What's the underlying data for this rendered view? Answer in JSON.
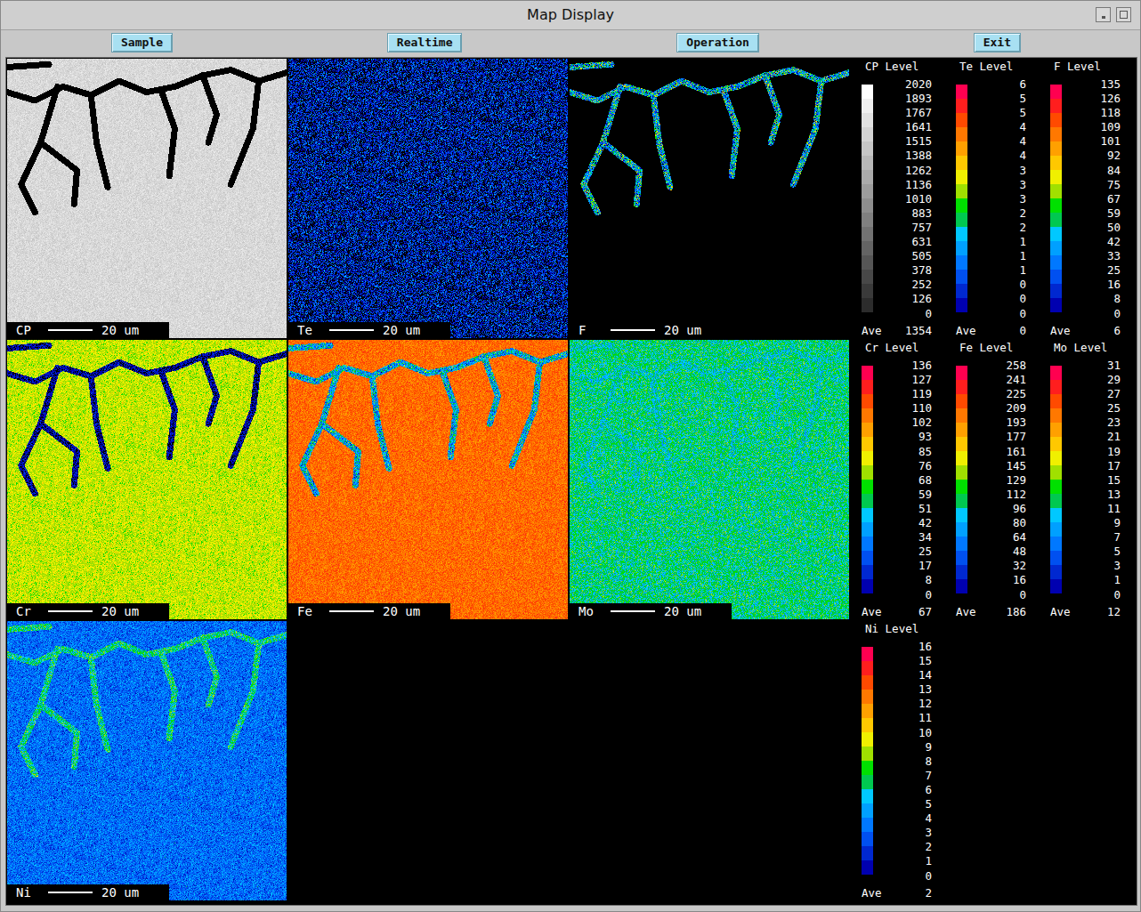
{
  "window": {
    "title": "Map Display",
    "controls": [
      "minimize",
      "maximize"
    ]
  },
  "toolbar": {
    "buttons": [
      "Sample",
      "Realtime",
      "Operation",
      "Exit"
    ]
  },
  "maps": [
    {
      "label": "CP",
      "scale_bar": "20 um",
      "scale": 0,
      "level": 0.8,
      "spread": 0.05,
      "boundary_level": -0.3,
      "boundary_spread": 0.05
    },
    {
      "label": "Te",
      "scale_bar": "20 um",
      "scale": 1,
      "level": 0.04,
      "spread": 0.16,
      "boundary_level": 0.04,
      "boundary_spread": 0.16
    },
    {
      "label": "F",
      "scale_bar": "20 um",
      "scale": 2,
      "level": -0.3,
      "spread": 0.03,
      "boundary_level": 0.3,
      "boundary_spread": 0.22
    },
    {
      "label": "Cr",
      "scale_bar": "20 um",
      "scale": 3,
      "level": 0.56,
      "spread": 0.05,
      "boundary_level": 0.03,
      "boundary_spread": 0.07
    },
    {
      "label": "Fe",
      "scale_bar": "20 um",
      "scale": 4,
      "level": 0.8,
      "spread": 0.05,
      "boundary_level": 0.3,
      "boundary_spread": 0.15
    },
    {
      "label": "Mo",
      "scale_bar": "20 um",
      "scale": 5,
      "level": 0.4,
      "spread": 0.08,
      "boundary_level": 0.36,
      "boundary_spread": 0.08
    },
    {
      "label": "Ni",
      "scale_bar": "20 um",
      "scale": 6,
      "level": 0.2,
      "spread": 0.08,
      "boundary_level": 0.4,
      "boundary_spread": 0.1
    }
  ],
  "scales": [
    {
      "title": "CP Level",
      "values": [
        "2020",
        "1893",
        "1767",
        "1641",
        "1515",
        "1388",
        "1262",
        "1136",
        "1010",
        "883",
        "757",
        "631",
        "505",
        "378",
        "252",
        "126",
        "0"
      ],
      "ave_label": "Ave",
      "ave": "1354",
      "colors": [
        "#ffffff",
        "#f0f0f0",
        "#e2e2e2",
        "#d4d4d4",
        "#c6c6c6",
        "#b8b8b8",
        "#aaaaaa",
        "#9c9c9c",
        "#8e8e8e",
        "#808080",
        "#727272",
        "#646464",
        "#565656",
        "#484848",
        "#3a3a3a",
        "#2c2c2c"
      ]
    },
    {
      "title": "Te Level",
      "values": [
        "6",
        "5",
        "5",
        "4",
        "4",
        "4",
        "3",
        "3",
        "3",
        "2",
        "2",
        "1",
        "1",
        "1",
        "0",
        "0",
        "0"
      ],
      "ave_label": "Ave",
      "ave": "0",
      "colors": [
        "#ff0050",
        "#ff1e1e",
        "#ff4a00",
        "#ff7800",
        "#ffa000",
        "#ffc800",
        "#f0f000",
        "#a0e000",
        "#00e000",
        "#00c850",
        "#00c8ff",
        "#00a0ff",
        "#0078ff",
        "#0050f0",
        "#0028d0",
        "#0000b0"
      ]
    },
    {
      "title": "F  Level",
      "values": [
        "135",
        "126",
        "118",
        "109",
        "101",
        "92",
        "84",
        "75",
        "67",
        "59",
        "50",
        "42",
        "33",
        "25",
        "16",
        "8",
        "0"
      ],
      "ave_label": "Ave",
      "ave": "6",
      "colors": [
        "#ff0050",
        "#ff1e1e",
        "#ff4a00",
        "#ff7800",
        "#ffa000",
        "#ffc800",
        "#f0f000",
        "#a0e000",
        "#00e000",
        "#00c850",
        "#00c8ff",
        "#00a0ff",
        "#0078ff",
        "#0050f0",
        "#0028d0",
        "#0000b0"
      ]
    },
    {
      "title": "Cr Level",
      "values": [
        "136",
        "127",
        "119",
        "110",
        "102",
        "93",
        "85",
        "76",
        "68",
        "59",
        "51",
        "42",
        "34",
        "25",
        "17",
        "8",
        "0"
      ],
      "ave_label": "Ave",
      "ave": "67",
      "colors": [
        "#ff0050",
        "#ff1e1e",
        "#ff4a00",
        "#ff7800",
        "#ffa000",
        "#ffc800",
        "#f0f000",
        "#a0e000",
        "#00e000",
        "#00c850",
        "#00c8ff",
        "#00a0ff",
        "#0078ff",
        "#0050f0",
        "#0028d0",
        "#0000b0"
      ]
    },
    {
      "title": "Fe Level",
      "values": [
        "258",
        "241",
        "225",
        "209",
        "193",
        "177",
        "161",
        "145",
        "129",
        "112",
        "96",
        "80",
        "64",
        "48",
        "32",
        "16",
        "0"
      ],
      "ave_label": "Ave",
      "ave": "186",
      "colors": [
        "#ff0050",
        "#ff1e1e",
        "#ff4a00",
        "#ff7800",
        "#ffa000",
        "#ffc800",
        "#f0f000",
        "#a0e000",
        "#00e000",
        "#00c850",
        "#00c8ff",
        "#00a0ff",
        "#0078ff",
        "#0050f0",
        "#0028d0",
        "#0000b0"
      ]
    },
    {
      "title": "Mo Level",
      "values": [
        "31",
        "29",
        "27",
        "25",
        "23",
        "21",
        "19",
        "17",
        "15",
        "13",
        "11",
        "9",
        "7",
        "5",
        "3",
        "1",
        "0"
      ],
      "ave_label": "Ave",
      "ave": "12",
      "colors": [
        "#ff0050",
        "#ff1e1e",
        "#ff4a00",
        "#ff7800",
        "#ffa000",
        "#ffc800",
        "#f0f000",
        "#a0e000",
        "#00e000",
        "#00c850",
        "#00c8ff",
        "#00a0ff",
        "#0078ff",
        "#0050f0",
        "#0028d0",
        "#0000b0"
      ]
    },
    {
      "title": "Ni Level",
      "values": [
        "16",
        "15",
        "14",
        "13",
        "12",
        "11",
        "10",
        "9",
        "8",
        "7",
        "6",
        "5",
        "4",
        "3",
        "2",
        "1",
        "0"
      ],
      "ave_label": "Ave",
      "ave": "2",
      "colors": [
        "#ff0050",
        "#ff1e1e",
        "#ff4a00",
        "#ff7800",
        "#ffa000",
        "#ffc800",
        "#f0f000",
        "#a0e000",
        "#00e000",
        "#00c850",
        "#00c8ff",
        "#00a0ff",
        "#0078ff",
        "#0050f0",
        "#0028d0",
        "#0000b0"
      ]
    }
  ]
}
